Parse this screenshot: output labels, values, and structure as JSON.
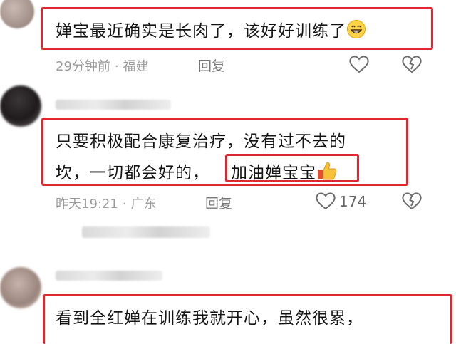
{
  "comments": [
    {
      "text_parts": [
        "婵宝最近确实是长肉了，该好好训练了"
      ],
      "time": "29分钟前",
      "location": "福建",
      "reply_label": "回复",
      "like_count": ""
    },
    {
      "line1": "只要积极配合康复治疗，没有过不去的",
      "line2": "坎，一切都会好的，",
      "highlight": "加油婵宝宝",
      "time": "昨天19:21",
      "location": "广东",
      "reply_label": "回复",
      "like_count": "174"
    },
    {
      "text_parts": [
        "看到全红婵在训练我就开心，虽然很累，"
      ]
    }
  ],
  "meta_separator": "·",
  "colors": {
    "highlight_border": "#e0262e",
    "meta_text": "#9a9a9a"
  },
  "icons": [
    "grin-emoji-icon",
    "heart-icon",
    "broken-heart-icon",
    "thumbs-up-emoji-icon"
  ]
}
